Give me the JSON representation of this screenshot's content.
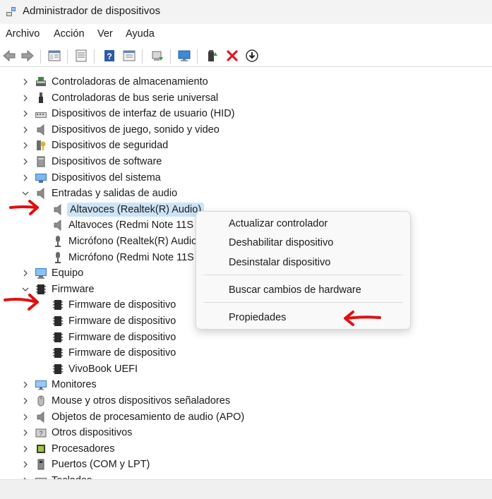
{
  "window": {
    "title": "Administrador de dispositivos"
  },
  "menu": {
    "items": [
      "Archivo",
      "Acción",
      "Ver",
      "Ayuda"
    ]
  },
  "toolbar": {
    "buttons": [
      "back-icon",
      "forward-icon",
      "properties-icon",
      "view-icon",
      "help-icon",
      "view-pane-icon",
      "update-driver-icon",
      "monitor-scan-icon",
      "enable-device-icon",
      "uninstall-icon",
      "download-icon"
    ]
  },
  "tree": {
    "items": [
      {
        "label": "Controladoras de almacenamiento",
        "icon": "storage-controller-icon"
      },
      {
        "label": "Controladoras de bus serie universal",
        "icon": "usb-icon"
      },
      {
        "label": "Dispositivos de interfaz de usuario (HID)",
        "icon": "hid-icon"
      },
      {
        "label": "Dispositivos de juego, sonido y video",
        "icon": "speaker-icon"
      },
      {
        "label": "Dispositivos de seguridad",
        "icon": "key-icon"
      },
      {
        "label": "Dispositivos de software",
        "icon": "software-device-icon"
      },
      {
        "label": "Dispositivos del sistema",
        "icon": "system-device-icon"
      },
      {
        "label": "Entradas y salidas de audio",
        "icon": "speaker-icon"
      },
      {
        "label": "Altavoces (Realtek(R) Audio)",
        "icon": "speaker-icon"
      },
      {
        "label": "Altavoces (Redmi Note 11S",
        "icon": "speaker-icon"
      },
      {
        "label": "Micrófono (Realtek(R) Audio",
        "icon": "microphone-icon"
      },
      {
        "label": "Micrófono (Redmi Note 11S",
        "icon": "microphone-icon"
      },
      {
        "label": "Equipo",
        "icon": "computer-icon"
      },
      {
        "label": "Firmware",
        "icon": "firmware-icon"
      },
      {
        "label": "Firmware de dispositivo",
        "icon": "firmware-icon"
      },
      {
        "label": "Firmware de dispositivo",
        "icon": "firmware-icon"
      },
      {
        "label": "Firmware de dispositivo",
        "icon": "firmware-icon"
      },
      {
        "label": "Firmware de dispositivo",
        "icon": "firmware-icon"
      },
      {
        "label": "VivoBook UEFI",
        "icon": "firmware-icon"
      },
      {
        "label": "Monitores",
        "icon": "monitor-icon"
      },
      {
        "label": "Mouse y otros dispositivos señaladores",
        "icon": "mouse-icon"
      },
      {
        "label": "Objetos de procesamiento de audio (APO)",
        "icon": "speaker-icon"
      },
      {
        "label": "Otros dispositivos",
        "icon": "unknown-device-icon"
      },
      {
        "label": "Procesadores",
        "icon": "processor-icon"
      },
      {
        "label": "Puertos (COM y LPT)",
        "icon": "port-icon"
      },
      {
        "label": "Teclados",
        "icon": "keyboard-icon"
      }
    ]
  },
  "context_menu": {
    "items": [
      "Actualizar controlador",
      "Deshabilitar dispositivo",
      "Desinstalar dispositivo",
      "Buscar cambios de hardware",
      "Propiedades"
    ]
  },
  "colors": {
    "accent": "#cce4f7",
    "annotation": "#e01010"
  }
}
